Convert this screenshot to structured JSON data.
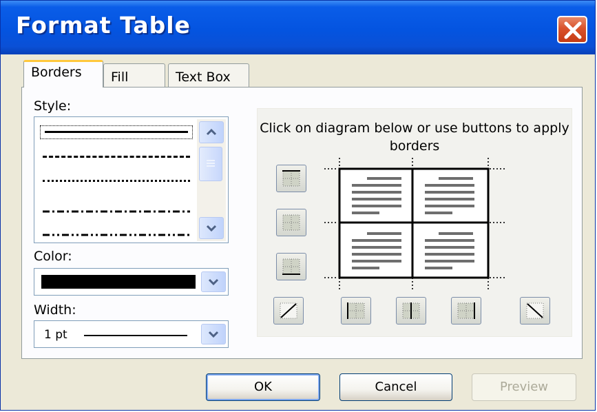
{
  "window": {
    "title": "Format Table"
  },
  "tabs": [
    {
      "label": "Borders",
      "selected": true
    },
    {
      "label": "Fill",
      "selected": false
    },
    {
      "label": "Text Box",
      "selected": false
    }
  ],
  "borders": {
    "style_label": "Style:",
    "style_options": [
      "solid",
      "dashed",
      "dotted",
      "dash-dot",
      "dash-dot-dot"
    ],
    "selected_style": "solid",
    "color_label": "Color:",
    "color_value": "#000000",
    "width_label": "Width:",
    "width_value": "1 pt",
    "instructions": "Click on diagram below or use buttons to apply borders"
  },
  "border_buttons": [
    {
      "name": "top-border-button",
      "icon": "border-top-icon"
    },
    {
      "name": "inside-horizontal-border-button",
      "icon": "border-inside-horizontal-icon"
    },
    {
      "name": "bottom-border-button",
      "icon": "border-bottom-icon"
    },
    {
      "name": "diagonal-up-border-button",
      "icon": "border-diagonal-up-icon"
    },
    {
      "name": "left-border-button",
      "icon": "border-left-icon"
    },
    {
      "name": "inside-vertical-border-button",
      "icon": "border-inside-vertical-icon"
    },
    {
      "name": "right-border-button",
      "icon": "border-right-icon"
    },
    {
      "name": "diagonal-down-border-button",
      "icon": "border-diagonal-down-icon"
    }
  ],
  "footer": {
    "ok": "OK",
    "cancel": "Cancel",
    "preview": "Preview",
    "preview_enabled": false
  },
  "colors": {
    "titlebar": "#0454e0",
    "dialog_bg": "#ece9d8",
    "close_button": "#d9522b",
    "tab_highlight": "#ffc83c"
  }
}
